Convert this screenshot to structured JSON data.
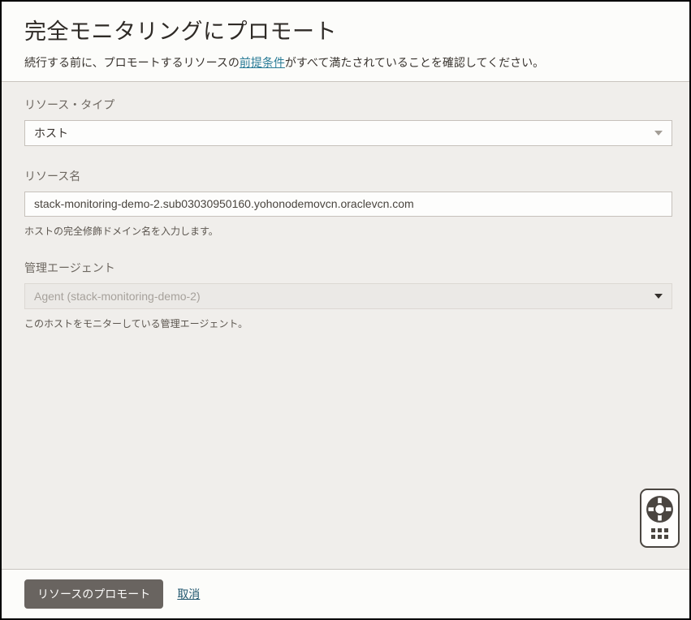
{
  "header": {
    "title": "完全モニタリングにプロモート",
    "subtitle_before": "続行する前に、プロモートするリソースの",
    "subtitle_link": "前提条件",
    "subtitle_after": "がすべて満たされていることを確認してください。"
  },
  "form": {
    "resource_type": {
      "label": "リソース・タイプ",
      "value": "ホスト"
    },
    "resource_name": {
      "label": "リソース名",
      "value": "stack-monitoring-demo-2.sub03030950160.yohonodemovcn.oraclevcn.com",
      "help": "ホストの完全修飾ドメイン名を入力します。"
    },
    "management_agent": {
      "label": "管理エージェント",
      "value": "Agent (stack-monitoring-demo-2)",
      "help": "このホストをモニターしている管理エージェント。",
      "state": "disabled"
    }
  },
  "footer": {
    "promote_label": "リソースのプロモート",
    "cancel_label": "取消"
  },
  "icons": {
    "dropdown_arrow": "chevron-down-triangle",
    "help": "life-preserver-icon",
    "launcher": "dots-grid-icon"
  },
  "colors": {
    "page_border": "#000000",
    "body_bg": "#f0eeeb",
    "panel_bg": "#fcfcfa",
    "link": "#2a7c97",
    "cancel_link": "#20566d",
    "button_bg": "#696460",
    "button_text": "#fbfaf9",
    "label_text": "#6e6861",
    "disabled_bg": "#ebe9e6",
    "disabled_text": "#a6a19b",
    "icon_dark": "#4a4540"
  }
}
